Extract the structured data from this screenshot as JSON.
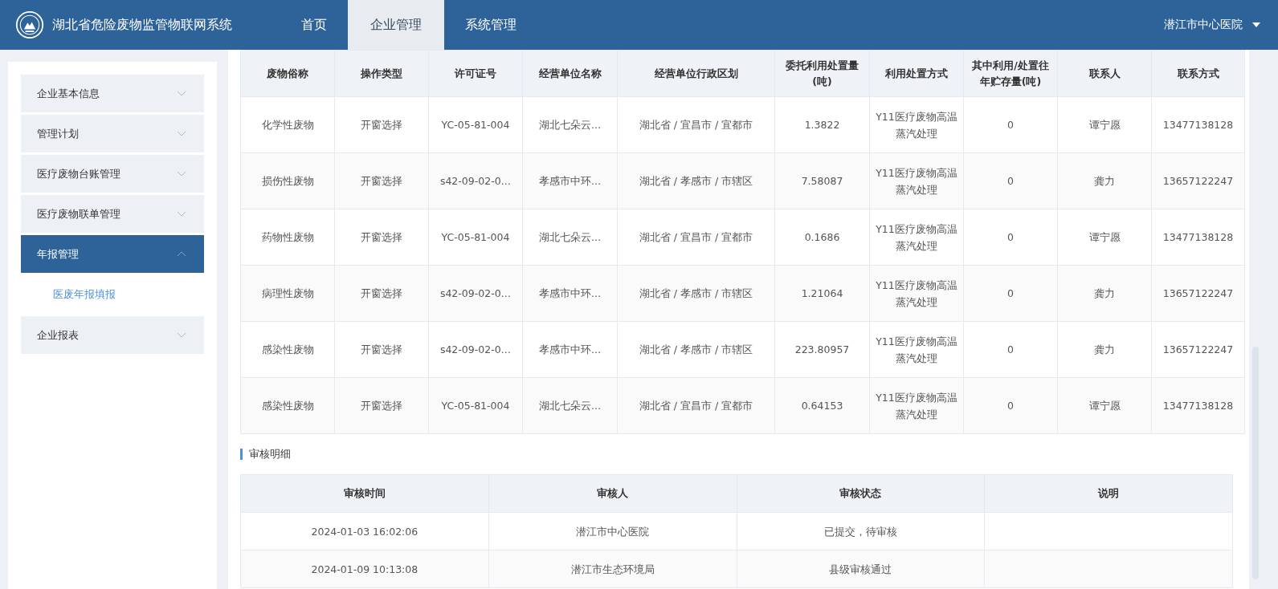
{
  "header": {
    "title": "湖北省危险废物监管物联网系统",
    "user": "潜江市中心医院"
  },
  "nav": [
    {
      "label": "首页",
      "selected": false
    },
    {
      "label": "企业管理",
      "selected": true
    },
    {
      "label": "系统管理",
      "selected": false
    }
  ],
  "sidebar": {
    "items": [
      {
        "label": "企业基本信息",
        "expanded": false,
        "selected": false
      },
      {
        "label": "管理计划",
        "expanded": false,
        "selected": false
      },
      {
        "label": "医疗废物台账管理",
        "expanded": false,
        "selected": false
      },
      {
        "label": "医疗废物联单管理",
        "expanded": false,
        "selected": false
      },
      {
        "label": "年报管理",
        "expanded": true,
        "selected": true,
        "children": [
          {
            "label": "医废年报填报",
            "selected": true
          }
        ]
      },
      {
        "label": "企业报表",
        "expanded": false,
        "selected": false
      }
    ]
  },
  "waste_table": {
    "columns": [
      "废物俗称",
      "操作类型",
      "许可证号",
      "经营单位名称",
      "经营单位行政区划",
      "委托利用处置量(吨)",
      "利用处置方式",
      "其中利用/处置往年贮存量(吨)",
      "联系人",
      "联系方式"
    ],
    "rows": [
      [
        "化学性废物",
        "开窗选择",
        "YC-05-81-004",
        "湖北七朵云…",
        "湖北省 / 宜昌市 / 宜都市",
        "1.3822",
        "Y11医疗废物高温蒸汽处理",
        "0",
        "谭宁愿",
        "13477138128"
      ],
      [
        "损伤性废物",
        "开窗选择",
        "s42-09-02-0…",
        "孝感市中环…",
        "湖北省 / 孝感市 / 市辖区",
        "7.58087",
        "Y11医疗废物高温蒸汽处理",
        "0",
        "龚力",
        "13657122247"
      ],
      [
        "药物性废物",
        "开窗选择",
        "YC-05-81-004",
        "湖北七朵云…",
        "湖北省 / 宜昌市 / 宜都市",
        "0.1686",
        "Y11医疗废物高温蒸汽处理",
        "0",
        "谭宁愿",
        "13477138128"
      ],
      [
        "病理性废物",
        "开窗选择",
        "s42-09-02-0…",
        "孝感市中环…",
        "湖北省 / 孝感市 / 市辖区",
        "1.21064",
        "Y11医疗废物高温蒸汽处理",
        "0",
        "龚力",
        "13657122247"
      ],
      [
        "感染性废物",
        "开窗选择",
        "s42-09-02-0…",
        "孝感市中环…",
        "湖北省 / 孝感市 / 市辖区",
        "223.80957",
        "Y11医疗废物高温蒸汽处理",
        "0",
        "龚力",
        "13657122247"
      ],
      [
        "感染性废物",
        "开窗选择",
        "YC-05-81-004",
        "湖北七朵云…",
        "湖北省 / 宜昌市 / 宜都市",
        "0.64153",
        "Y11医疗废物高温蒸汽处理",
        "0",
        "谭宁愿",
        "13477138128"
      ]
    ]
  },
  "audit": {
    "title": "审核明细",
    "columns": [
      "审核时间",
      "审核人",
      "审核状态",
      "说明"
    ],
    "rows": [
      [
        "2024-01-03 16:02:06",
        "潜江市中心医院",
        "已提交，待审核",
        ""
      ],
      [
        "2024-01-09 10:13:08",
        "潜江市生态环境局",
        "县级审核通过",
        ""
      ]
    ]
  }
}
